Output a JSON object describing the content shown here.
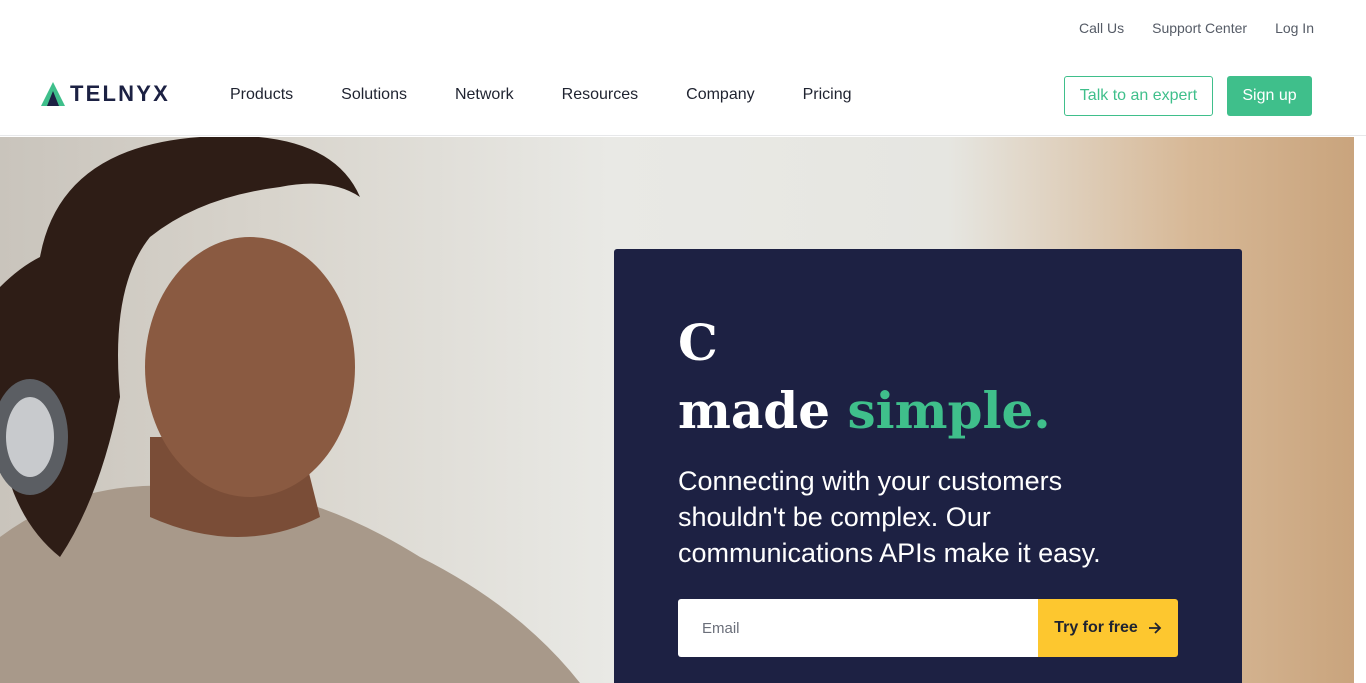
{
  "utility_nav": {
    "call_us": "Call Us",
    "support_center": "Support Center",
    "log_in": "Log In"
  },
  "brand": {
    "name": "TELNYX",
    "accent_color": "#3fbf8b",
    "dark_color": "#1c2143"
  },
  "main_nav": {
    "items": [
      "Products",
      "Solutions",
      "Network",
      "Resources",
      "Company",
      "Pricing"
    ]
  },
  "actions": {
    "talk_expert": "Talk to an expert",
    "sign_up": "Sign up"
  },
  "hero": {
    "headline_line1": "C",
    "headline_line2_plain": "made ",
    "headline_line2_accent": "simple.",
    "subtext": "Connecting with your customers shouldn't be complex. Our communications APIs make it easy.",
    "email_placeholder": "Email",
    "cta_label": "Try for free",
    "cta_color": "#fdc72f",
    "card_color": "#1d2143",
    "cta_icon": "arrow-right-icon"
  }
}
